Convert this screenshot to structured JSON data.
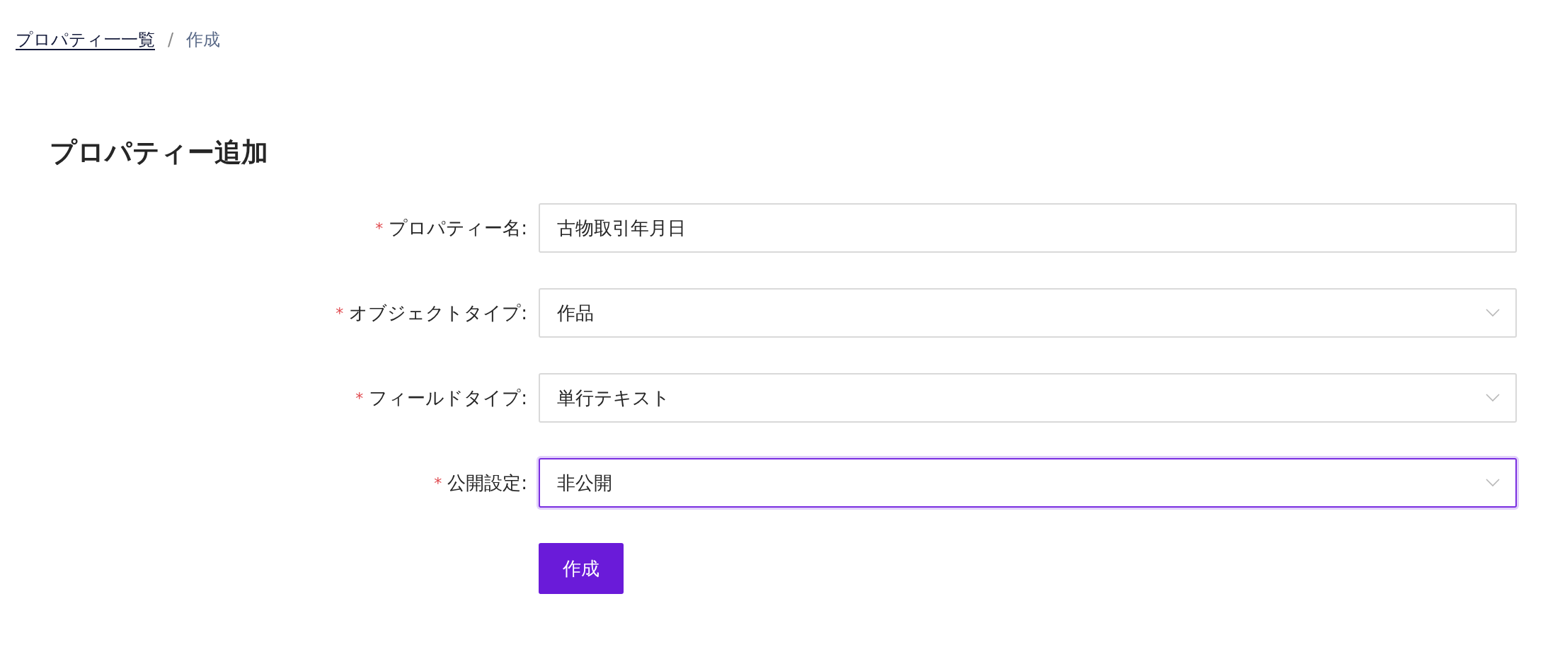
{
  "breadcrumb": {
    "items": [
      {
        "label": "プロパティ一一覧",
        "kind": "link"
      },
      {
        "label": "作成",
        "kind": "current"
      }
    ],
    "separator": "/"
  },
  "title": "プロパティー追加",
  "form": {
    "fields": [
      {
        "label": "プロパティー名:",
        "required_mark": "*",
        "kind": "text",
        "value": "古物取引年月日",
        "focused": false
      },
      {
        "label": "オブジェクトタイプ:",
        "required_mark": "*",
        "kind": "select",
        "value": "作品",
        "focused": false
      },
      {
        "label": "フィールドタイプ:",
        "required_mark": "*",
        "kind": "select",
        "value": "単行テキスト",
        "focused": false
      },
      {
        "label": "公開設定:",
        "required_mark": "*",
        "kind": "select",
        "value": "非公開",
        "focused": true
      }
    ],
    "submit": "作成"
  }
}
